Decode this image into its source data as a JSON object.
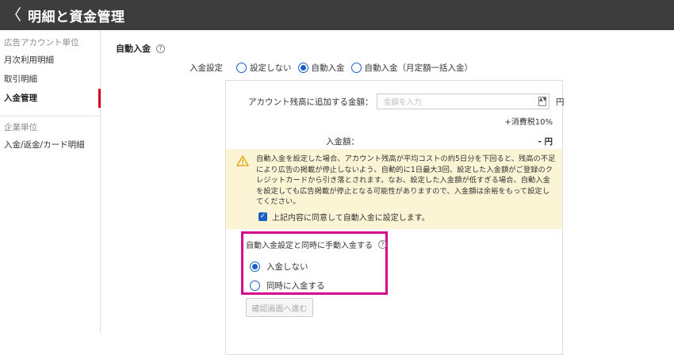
{
  "header": {
    "back_icon": "chevron-left-icon",
    "back": "〈",
    "title": "明細と資金管理"
  },
  "sidebar": {
    "group1": "広告アカウント単位",
    "items1": [
      "月次利用明細",
      "取引明細",
      "入金管理"
    ],
    "group2": "企業単位",
    "items2": [
      "入金/返金/カード明細"
    ],
    "active": "入金管理"
  },
  "main": {
    "section_title": "自動入金",
    "help": "?",
    "setting_label": "入金設定",
    "radio_options": [
      "設定しない",
      "自動入金",
      "自動入金（月定額一括入金）"
    ],
    "selected": "自動入金",
    "amount_label": "アカウント残高に追加する金額：",
    "amount_placeholder": "金額を入力",
    "stepper": "▲▼",
    "yen": "円",
    "tax_note": "+消費税10%",
    "deposit_label": "入金額：",
    "deposit_value": "- 円",
    "warning": "自動入金を設定した場合、アカウント残高が平均コストの約5日分を下回ると、残高の不足により広告の掲載が停止しないよう、自動的に1日最大3回、設定した入金額がご登録のクレジットカードから引き落とされます。なお、設定した入金額が低すぎる場合、自動入金を設定しても広告掲載が停止となる可能性がありますので、入金額は余裕をもって設定してください。",
    "agree_label": "上記内容に同意して自動入金に設定します。",
    "check": "✓",
    "manual_title": "自動入金設定と同時に手動入金する",
    "manual_options": [
      "入金しない",
      "同時に入金する"
    ],
    "manual_selected": "入金しない",
    "confirm_button": "確認画面へ進む",
    "colors": {
      "accent": "#1a5fc4",
      "highlight": "#d4088c",
      "warning_bg": "#fbf5d6",
      "active_marker": "#d0021b"
    }
  }
}
